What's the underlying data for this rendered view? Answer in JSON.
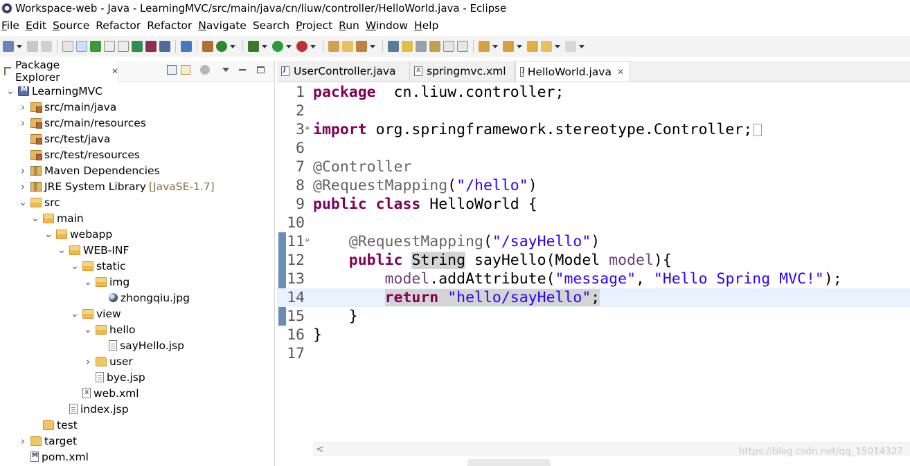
{
  "window": {
    "title": "Workspace-web - Java - LearningMVC/src/main/java/cn/liuw/controller/HelloWorld.java - Eclipse"
  },
  "menubar": [
    {
      "mnemonic": "F",
      "rest": "ile"
    },
    {
      "mnemonic": "E",
      "rest": "dit"
    },
    {
      "mnemonic": "S",
      "rest": "ource"
    },
    {
      "mnemonic": "",
      "rest": "Refactor"
    },
    {
      "mnemonic": "",
      "rest": "Refactor"
    },
    {
      "mnemonic": "N",
      "rest": "avigate"
    },
    {
      "mnemonic": "",
      "rest": "Search"
    },
    {
      "mnemonic": "P",
      "rest": "roject"
    },
    {
      "mnemonic": "R",
      "rest": "un"
    },
    {
      "mnemonic": "W",
      "rest": "indow"
    },
    {
      "mnemonic": "H",
      "rest": "elp"
    }
  ],
  "package_explorer": {
    "tab_label": "Package Explorer",
    "close_glyph": "✕",
    "tree": [
      {
        "label": "LearningMVC",
        "icon": "project-icon",
        "expanded": true
      },
      {
        "label": "src/main/java",
        "icon": "package-folder-icon",
        "expanded": false
      },
      {
        "label": "src/main/resources",
        "icon": "package-folder-icon",
        "expanded": false
      },
      {
        "label": "src/test/java",
        "icon": "package-folder-icon",
        "expanded": null
      },
      {
        "label": "src/test/resources",
        "icon": "package-folder-icon",
        "expanded": null
      },
      {
        "label": "Maven Dependencies",
        "icon": "library-icon",
        "expanded": false
      },
      {
        "label": "JRE System Library",
        "icon": "library-icon",
        "expanded": false,
        "decoration": "[JavaSE-1.7]"
      },
      {
        "label": "src",
        "icon": "folder-icon",
        "expanded": true
      },
      {
        "label": "main",
        "icon": "folder-icon",
        "expanded": true
      },
      {
        "label": "webapp",
        "icon": "folder-icon",
        "expanded": true
      },
      {
        "label": "WEB-INF",
        "icon": "folder-icon",
        "expanded": true
      },
      {
        "label": "static",
        "icon": "folder-icon",
        "expanded": true
      },
      {
        "label": "img",
        "icon": "folder-icon",
        "expanded": true
      },
      {
        "label": "zhongqiu.jpg",
        "icon": "image-file-icon",
        "expanded": null
      },
      {
        "label": "view",
        "icon": "folder-icon",
        "expanded": true
      },
      {
        "label": "hello",
        "icon": "folder-icon",
        "expanded": true
      },
      {
        "label": "sayHello.jsp",
        "icon": "jsp-file-icon",
        "expanded": null
      },
      {
        "label": "user",
        "icon": "folder-icon",
        "expanded": false
      },
      {
        "label": "bye.jsp",
        "icon": "jsp-file-icon",
        "expanded": null
      },
      {
        "label": "web.xml",
        "icon": "xml-file-icon",
        "expanded": null
      },
      {
        "label": "index.jsp",
        "icon": "jsp-file-icon",
        "expanded": null
      },
      {
        "label": "test",
        "icon": "folder-icon",
        "expanded": null
      },
      {
        "label": "target",
        "icon": "folder-icon",
        "expanded": false
      },
      {
        "label": "pom.xml",
        "icon": "pom-file-icon",
        "expanded": null
      }
    ]
  },
  "editor": {
    "tabs": [
      {
        "label": "UserController.java",
        "icon": "java-file-icon",
        "active": false
      },
      {
        "label": "springmvc.xml",
        "icon": "xml-file-icon",
        "active": false
      },
      {
        "label": "HelloWorld.java",
        "icon": "java-file-icon",
        "active": true
      }
    ],
    "close_glyph": "✕",
    "current_line": 14,
    "lines": [
      {
        "n": "1",
        "tokens": [
          [
            "kw",
            "package"
          ],
          [
            "",
            "  cn.liuw.controller;"
          ]
        ]
      },
      {
        "n": "2",
        "tokens": []
      },
      {
        "n": "3",
        "fold": "⊕",
        "tokens": [
          [
            "kw",
            "import"
          ],
          [
            "",
            " org.springframework.stereotype.Controller;"
          ]
        ],
        "folded_box": true
      },
      {
        "n": "6",
        "tokens": []
      },
      {
        "n": "7",
        "tokens": [
          [
            "ann",
            "@Controller"
          ]
        ]
      },
      {
        "n": "8",
        "tokens": [
          [
            "ann",
            "@RequestMapping"
          ],
          [
            "",
            "("
          ],
          [
            "str",
            "\"/hello\""
          ],
          [
            "",
            ")"
          ]
        ]
      },
      {
        "n": "9",
        "tokens": [
          [
            "kw",
            "public"
          ],
          [
            "",
            " "
          ],
          [
            "kw",
            "class"
          ],
          [
            "",
            " HelloWorld {"
          ]
        ]
      },
      {
        "n": "10",
        "tokens": []
      },
      {
        "n": "11",
        "fold": "⊖",
        "tokens": [
          [
            "",
            "    "
          ],
          [
            "ann",
            "@RequestMapping"
          ],
          [
            "",
            "("
          ],
          [
            "str",
            "\"/sayHello\""
          ],
          [
            "",
            ")"
          ]
        ]
      },
      {
        "n": "12",
        "tokens": [
          [
            "",
            "    "
          ],
          [
            "kw",
            "public"
          ],
          [
            "",
            " "
          ],
          [
            "hl",
            "String"
          ],
          [
            "",
            " sayHello(Model "
          ],
          [
            "fld",
            "model"
          ],
          [
            "",
            "){"
          ]
        ]
      },
      {
        "n": "13",
        "tokens": [
          [
            "",
            "        "
          ],
          [
            "fld",
            "model"
          ],
          [
            "",
            ".addAttribute("
          ],
          [
            "str",
            "\"message\""
          ],
          [
            "",
            ", "
          ],
          [
            "str",
            "\"Hello Spring MVC!\""
          ],
          [
            "",
            ");"
          ]
        ]
      },
      {
        "n": "14",
        "tokens": [
          [
            "",
            "        "
          ],
          [
            "kw-hl",
            "return"
          ],
          [
            "hl",
            " "
          ],
          [
            "str-hl",
            "\"hello/sayHello\""
          ],
          [
            "hl",
            ";"
          ]
        ]
      },
      {
        "n": "15",
        "tokens": [
          [
            "",
            "    }"
          ]
        ]
      },
      {
        "n": "16",
        "tokens": [
          [
            "",
            "}"
          ]
        ]
      },
      {
        "n": "17",
        "tokens": []
      }
    ]
  },
  "watermark": "https://blog.csdn.net/qq_15014327"
}
